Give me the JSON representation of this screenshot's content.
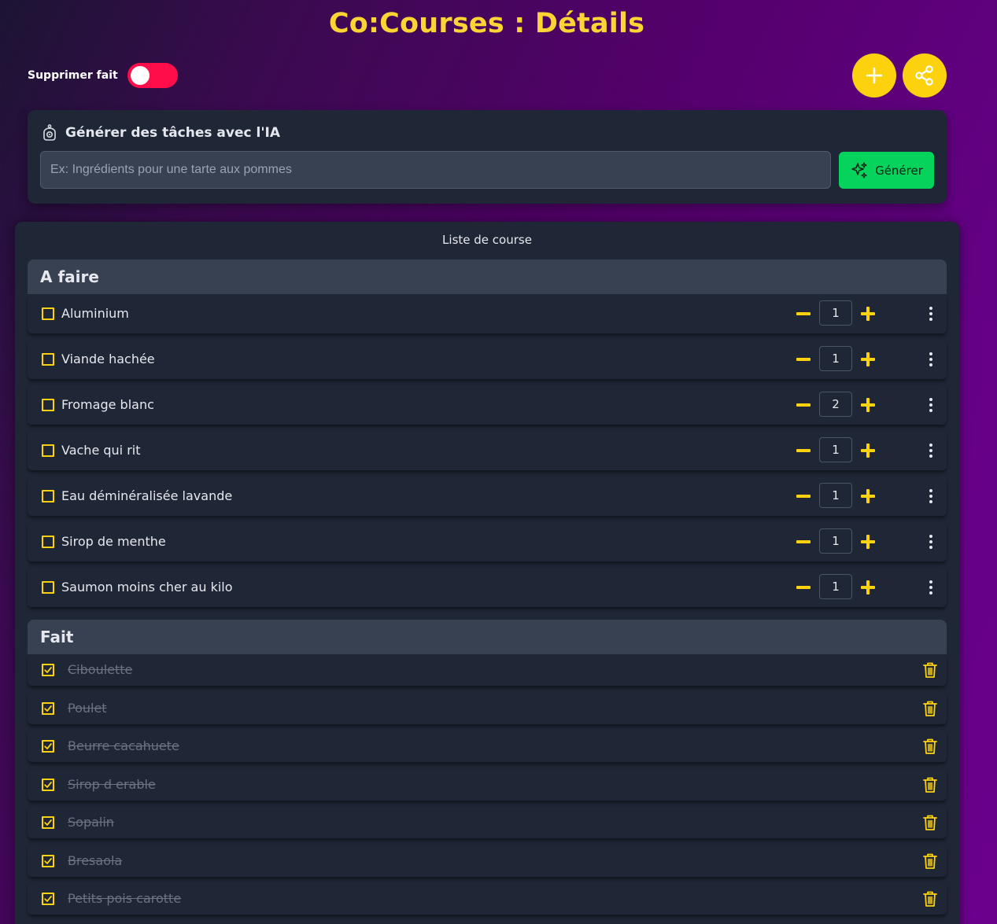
{
  "header": {
    "title": "Co:Courses : Détails"
  },
  "toolbar": {
    "toggle_label": "Supprimer fait",
    "toggle_on": true,
    "add_icon": "plus-icon",
    "share_icon": "share-icon"
  },
  "ai_generator": {
    "title": "Générer des tâches avec l'IA",
    "icon": "robot-icon",
    "placeholder": "Ex: Ingrédients pour une tarte aux pommes",
    "value": "",
    "button_label": "Générer",
    "button_icon": "sparkles-icon"
  },
  "list": {
    "title": "Liste de course",
    "todo_section": {
      "title": "A faire",
      "items": [
        {
          "label": "Aluminium",
          "qty": "1"
        },
        {
          "label": "Viande hachée",
          "qty": "1"
        },
        {
          "label": "Fromage blanc",
          "qty": "2"
        },
        {
          "label": "Vache qui rit",
          "qty": "1"
        },
        {
          "label": "Eau déminéralisée lavande",
          "qty": "1"
        },
        {
          "label": "Sirop de menthe",
          "qty": "1"
        },
        {
          "label": "Saumon moins cher au kilo",
          "qty": "1"
        }
      ]
    },
    "done_section": {
      "title": "Fait",
      "items": [
        {
          "label": "Ciboulette"
        },
        {
          "label": "Poulet"
        },
        {
          "label": "Beurre cacahuete"
        },
        {
          "label": "Sirop d erable"
        },
        {
          "label": "Sopalin"
        },
        {
          "label": "Bresaola"
        },
        {
          "label": "Petits pois carotte"
        }
      ]
    }
  },
  "colors": {
    "accent": "#fcd20f",
    "title": "#fcd535",
    "toggle_active": "#ff0d4b",
    "generate_button": "#05d35c",
    "card_bg": "#1f2736",
    "section_bg": "#374151"
  }
}
